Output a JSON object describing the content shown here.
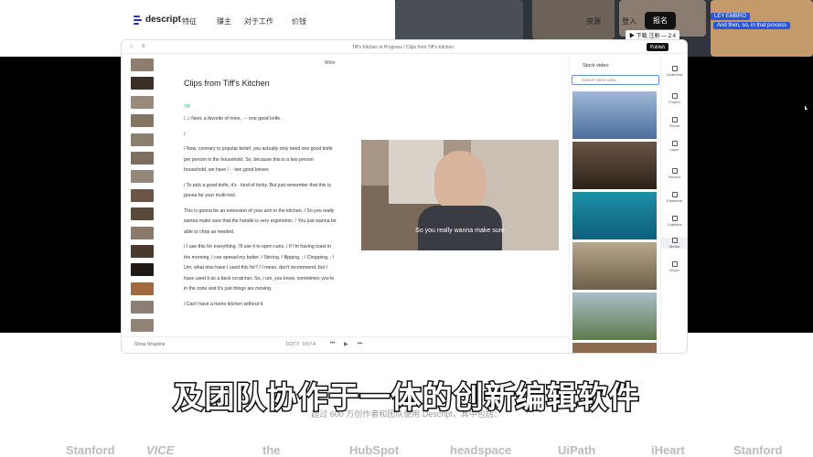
{
  "nav": {
    "brand": "descript",
    "items": [
      "特征",
      "赚主",
      "对于工作",
      "价钱"
    ],
    "resources": "资源",
    "login": "登入",
    "signup": "报名"
  },
  "collage": {
    "chip1": "▶ 下载 注册 — 2:4",
    "chip2": "LEY EMBRO",
    "chip3": "And then, so, in that process"
  },
  "app": {
    "breadcrumb": "Tiff's Kitchen in Progress  /  Clips from Tiff's Kitchen",
    "publish": "Publish",
    "write": "Write",
    "doc_title": "Clips from Tiff's Kitchen",
    "speaker": "Tiff",
    "paragraphs": [
      "/  ♫  Next, a favorite of mine,  ···  one good knife.",
      "/",
      "/  Now, contrary to popular belief, you actually only need one good knife per person in the household. So, because this is a two person household, we have  /  ··  two good knives",
      "/  To pick a good knife, it's  ·  kind of tricky. But just remember that this is gonna be your multi-tool.",
      "This is gonna be an extension of your arm in the kitchen.  /  So you really wanna make sure that the handle is very ergonomic.  /  You just wanna be able to chop as needed.",
      "/  I use this for everything. I'll use it to open cans,  /  If I'm having toast in the morning, I can spread my butter.  /  Stirring,  /  flipping,  ;  /  Chopping,  ;  /  Um, what else have I used this for?  /  I mean, don't recommend, but I have used it as a back scratcher. So,  /  um, you know, sometimes you're in the zone and it's just things are moving.",
      "/  Can't have a home kitchen without it."
    ],
    "video_subtitle": "So you really wanna make sure",
    "show_wrap": "Show Wrapline",
    "time_current": "0:27.7",
    "time_total": "0:57.4",
    "stock_title": "Stock video",
    "stock_search": "Search stock video",
    "rail": [
      "Underlord",
      "Project",
      "Scene",
      "Layer",
      "Record",
      "Elements",
      "Captions",
      "Media",
      "Music"
    ]
  },
  "bottom": {
    "big_subtitle": "及团队协作于一体的创新编辑软件",
    "small_line": "超过 600 万创作者和团队使用 Descript，其中包括：",
    "logos": [
      "Stanford",
      "VICE",
      "the",
      "HubSpot",
      "headspace",
      "UiPath",
      "iHeart",
      "Stanford"
    ]
  }
}
